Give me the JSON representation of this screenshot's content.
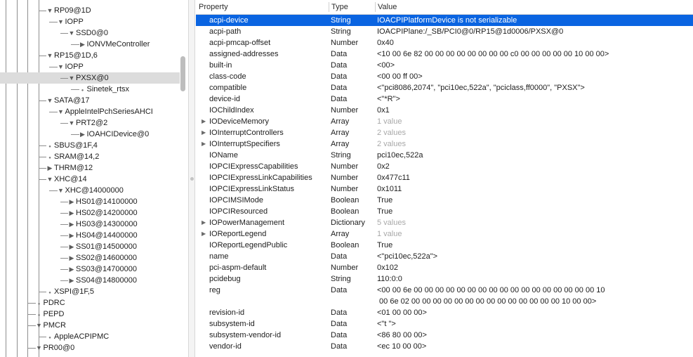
{
  "tree": [
    {
      "label": "RP09@1D",
      "indent": 4,
      "kind": "expanded"
    },
    {
      "label": "IOPP",
      "indent": 5,
      "kind": "expanded"
    },
    {
      "label": "SSD0@0",
      "indent": 6,
      "kind": "expanded"
    },
    {
      "label": "IONVMeController",
      "indent": 7,
      "kind": "collapsed"
    },
    {
      "label": "RP15@1D,6",
      "indent": 4,
      "kind": "expanded"
    },
    {
      "label": "IOPP",
      "indent": 5,
      "kind": "expanded"
    },
    {
      "label": "PXSX@0",
      "indent": 6,
      "kind": "expanded",
      "selected": true
    },
    {
      "label": "Sinetek_rtsx",
      "indent": 7,
      "kind": "leaf"
    },
    {
      "label": "SATA@17",
      "indent": 4,
      "kind": "expanded"
    },
    {
      "label": "AppleIntelPchSeriesAHCI",
      "indent": 5,
      "kind": "expanded"
    },
    {
      "label": "PRT2@2",
      "indent": 6,
      "kind": "expanded"
    },
    {
      "label": "IOAHCIDevice@0",
      "indent": 7,
      "kind": "collapsed"
    },
    {
      "label": "SBUS@1F,4",
      "indent": 4,
      "kind": "leaf"
    },
    {
      "label": "SRAM@14,2",
      "indent": 4,
      "kind": "leaf"
    },
    {
      "label": "THRM@12",
      "indent": 4,
      "kind": "collapsed"
    },
    {
      "label": "XHC@14",
      "indent": 4,
      "kind": "expanded"
    },
    {
      "label": "XHC@14000000",
      "indent": 5,
      "kind": "expanded"
    },
    {
      "label": "HS01@14100000",
      "indent": 6,
      "kind": "collapsed"
    },
    {
      "label": "HS02@14200000",
      "indent": 6,
      "kind": "collapsed"
    },
    {
      "label": "HS03@14300000",
      "indent": 6,
      "kind": "collapsed"
    },
    {
      "label": "HS04@14400000",
      "indent": 6,
      "kind": "collapsed"
    },
    {
      "label": "SS01@14500000",
      "indent": 6,
      "kind": "collapsed"
    },
    {
      "label": "SS02@14600000",
      "indent": 6,
      "kind": "collapsed"
    },
    {
      "label": "SS03@14700000",
      "indent": 6,
      "kind": "collapsed"
    },
    {
      "label": "SS04@14800000",
      "indent": 6,
      "kind": "collapsed"
    },
    {
      "label": "XSPI@1F,5",
      "indent": 4,
      "kind": "leaf"
    },
    {
      "label": "PDRC",
      "indent": 3,
      "kind": "leaf"
    },
    {
      "label": "PEPD",
      "indent": 3,
      "kind": "leaf"
    },
    {
      "label": "PMCR",
      "indent": 3,
      "kind": "expanded"
    },
    {
      "label": "AppleACPIPMC",
      "indent": 4,
      "kind": "leaf"
    },
    {
      "label": "PR00@0",
      "indent": 3,
      "kind": "expanded"
    }
  ],
  "columns": {
    "property": "Property",
    "type": "Type",
    "value": "Value"
  },
  "rows": [
    {
      "key": "acpi-device",
      "type": "String",
      "value": "IOACPIPlatformDevice is not serializable",
      "selected": true
    },
    {
      "key": "acpi-path",
      "type": "String",
      "value": "IOACPIPlane:/_SB/PCI0@0/RP15@1d0006/PXSX@0"
    },
    {
      "key": "acpi-pmcap-offset",
      "type": "Number",
      "value": "0x40"
    },
    {
      "key": "assigned-addresses",
      "type": "Data",
      "value": "<10 00 6e 82 00 00 00 00 00 00 00 00 c0 00 00 00 00 00 10 00 00>"
    },
    {
      "key": "built-in",
      "type": "Data",
      "value": "<00>"
    },
    {
      "key": "class-code",
      "type": "Data",
      "value": "<00 00 ff 00>"
    },
    {
      "key": "compatible",
      "type": "Data",
      "value": "<\"pci8086,2074\", \"pci10ec,522a\", \"pciclass,ff0000\", \"PXSX\">"
    },
    {
      "key": "device-id",
      "type": "Data",
      "value": "<\"*R\">"
    },
    {
      "key": "IOChildIndex",
      "type": "Number",
      "value": "0x1"
    },
    {
      "key": "IODeviceMemory",
      "type": "Array",
      "value": "1 value",
      "dim": true,
      "expandable": true
    },
    {
      "key": "IOInterruptControllers",
      "type": "Array",
      "value": "2 values",
      "dim": true,
      "expandable": true
    },
    {
      "key": "IOInterruptSpecifiers",
      "type": "Array",
      "value": "2 values",
      "dim": true,
      "expandable": true
    },
    {
      "key": "IOName",
      "type": "String",
      "value": "pci10ec,522a"
    },
    {
      "key": "IOPCIExpressCapabilities",
      "type": "Number",
      "value": "0x2"
    },
    {
      "key": "IOPCIExpressLinkCapabilities",
      "type": "Number",
      "value": "0x477c11"
    },
    {
      "key": "IOPCIExpressLinkStatus",
      "type": "Number",
      "value": "0x1011"
    },
    {
      "key": "IOPCIMSIMode",
      "type": "Boolean",
      "value": "True"
    },
    {
      "key": "IOPCIResourced",
      "type": "Boolean",
      "value": "True"
    },
    {
      "key": "IOPowerManagement",
      "type": "Dictionary",
      "value": "5 values",
      "dim": true,
      "expandable": true
    },
    {
      "key": "IOReportLegend",
      "type": "Array",
      "value": "1 value",
      "dim": true,
      "expandable": true
    },
    {
      "key": "IOReportLegendPublic",
      "type": "Boolean",
      "value": "True"
    },
    {
      "key": "name",
      "type": "Data",
      "value": "<\"pci10ec,522a\">"
    },
    {
      "key": "pci-aspm-default",
      "type": "Number",
      "value": "0x102"
    },
    {
      "key": "pcidebug",
      "type": "String",
      "value": "110:0:0"
    },
    {
      "key": "reg",
      "type": "Data",
      "value": "<00 00 6e 00 00 00 00 00 00 00 00 00 00 00 00 00 00 00 00 00 10\n 00 6e 02 00 00 00 00 00 00 00 00 00 00 00 00 00 00 10 00 00>",
      "multiline": true
    },
    {
      "key": "revision-id",
      "type": "Data",
      "value": "<01 00 00 00>"
    },
    {
      "key": "subsystem-id",
      "type": "Data",
      "value": "<\"t \">"
    },
    {
      "key": "subsystem-vendor-id",
      "type": "Data",
      "value": "<86 80 00 00>"
    },
    {
      "key": "vendor-id",
      "type": "Data",
      "value": "<ec 10 00 00>"
    }
  ]
}
